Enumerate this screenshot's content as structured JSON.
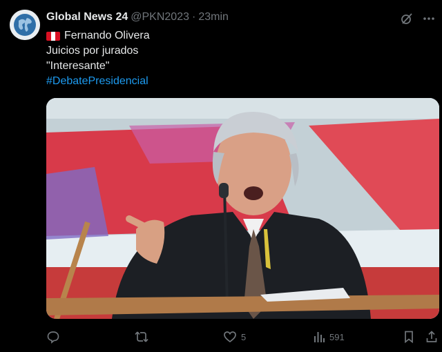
{
  "tweet": {
    "author_name": "Global News 24",
    "handle": "@PKN2023",
    "separator": "·",
    "time": "23min",
    "flag_emoji": "🇵🇪",
    "lines": [
      "Fernando Olivera",
      "Juicios por jurados",
      "\"Interesante\""
    ],
    "hashtag": "#DebatePresidencial"
  },
  "actions": {
    "replies": "",
    "retweets": "",
    "likes": "5",
    "views": "591"
  },
  "colors": {
    "background": "#000000",
    "text": "#e7e9ea",
    "muted": "#71767b",
    "link": "#1d9bf0"
  },
  "icons": [
    "grok-icon",
    "more-icon",
    "reply-icon",
    "retweet-icon",
    "like-icon",
    "views-icon",
    "bookmark-icon",
    "share-icon"
  ]
}
